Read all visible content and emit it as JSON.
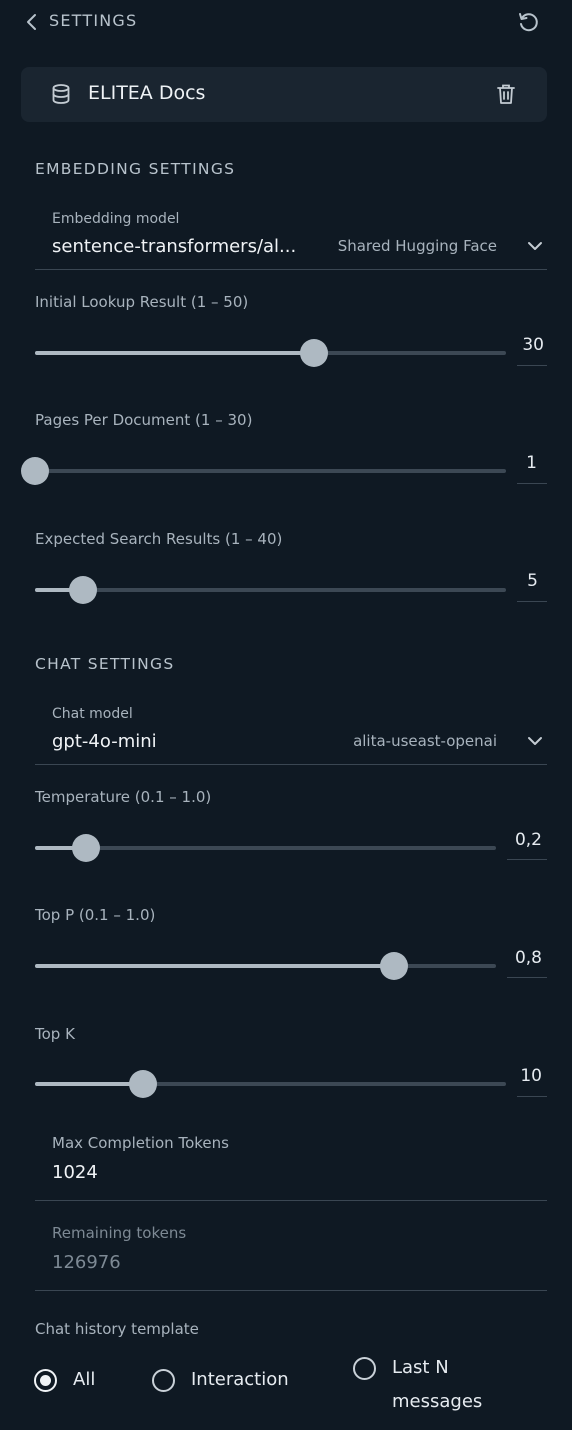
{
  "header": {
    "title": "SETTINGS",
    "back_icon": "chevron-left-icon",
    "reset_icon": "reset-icon"
  },
  "datasource": {
    "name": "ELITEA Docs",
    "db_icon": "database-icon",
    "delete_icon": "trash-icon"
  },
  "embedding": {
    "section_title": "EMBEDDING SETTINGS",
    "model_label": "Embedding model",
    "model_value": "sentence-transformers/al...",
    "model_provider": "Shared Hugging Face",
    "sliders": [
      {
        "label": "Initial Lookup Result (1 – 50)",
        "value": "30",
        "min": 1,
        "max": 50,
        "current": 30
      },
      {
        "label": "Pages Per Document (1 – 30)",
        "value": "1",
        "min": 1,
        "max": 30,
        "current": 1
      },
      {
        "label": "Expected Search Results (1 – 40)",
        "value": "5",
        "min": 1,
        "max": 40,
        "current": 5
      }
    ]
  },
  "chat": {
    "section_title": "CHAT SETTINGS",
    "model_label": "Chat model",
    "model_value": "gpt-4o-mini",
    "model_provider": "alita-useast-openai",
    "sliders": [
      {
        "label": "Temperature (0.1 – 1.0)",
        "value": "0,2",
        "min": 0.1,
        "max": 1.0,
        "current": 0.2
      },
      {
        "label": "Top P (0.1 – 1.0)",
        "value": "0,8",
        "min": 0.1,
        "max": 1.0,
        "current": 0.8
      },
      {
        "label": "Top K",
        "value": "10",
        "fraction": 0.23
      }
    ],
    "max_tokens_label": "Max Completion Tokens",
    "max_tokens_value": "1024",
    "remaining_label": "Remaining tokens",
    "remaining_value": "126976",
    "history_label": "Chat history template",
    "history_options": [
      {
        "label": "All",
        "checked": true
      },
      {
        "label": "Interaction",
        "checked": false
      },
      {
        "label_line1": "Last N",
        "label_line2": "messages",
        "checked": false
      }
    ]
  }
}
